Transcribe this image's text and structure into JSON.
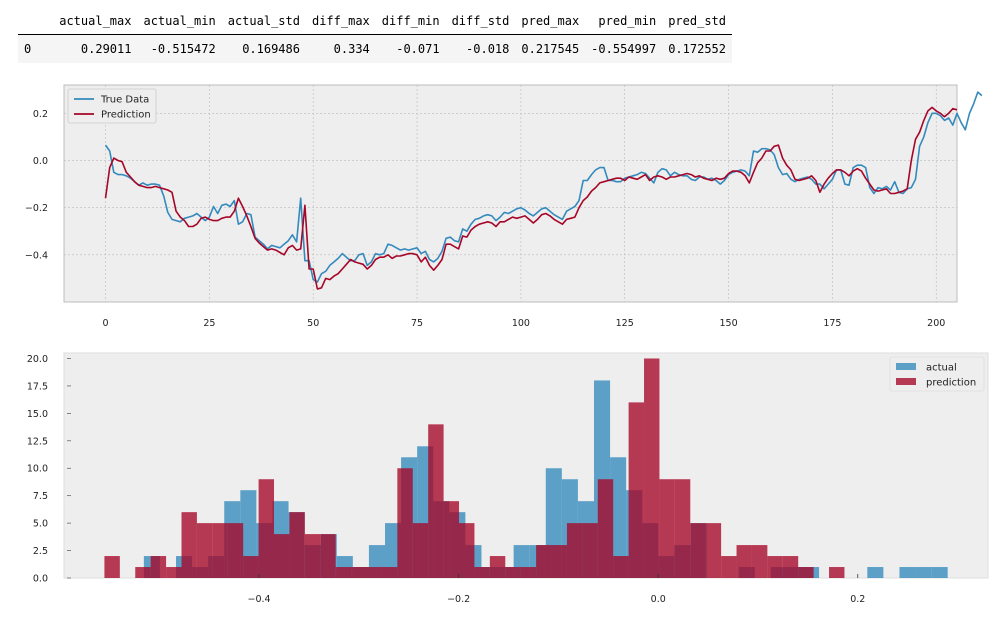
{
  "table": {
    "index_header": "",
    "columns": [
      "actual_max",
      "actual_min",
      "actual_std",
      "diff_max",
      "diff_min",
      "diff_std",
      "pred_max",
      "pred_min",
      "pred_std"
    ],
    "rows": [
      {
        "index": "0",
        "values": [
          "0.29011",
          "-0.515472",
          "0.169486",
          "0.334",
          "-0.071",
          "-0.018",
          "0.217545",
          "-0.554997",
          "0.172552"
        ]
      }
    ]
  },
  "colors": {
    "true_line": "#348ABD",
    "pred_line": "#A60628",
    "hist_actual": "#348ABD",
    "hist_pred": "#A60628",
    "plot_bg": "#EEEEEE",
    "grid": "#BBBBBB"
  },
  "chart_data": [
    {
      "type": "line",
      "title": "",
      "xlabel": "",
      "ylabel": "",
      "xlim": [
        -10,
        205
      ],
      "ylim": [
        -0.6,
        0.32
      ],
      "xticks": [
        0,
        25,
        50,
        75,
        100,
        125,
        150,
        175,
        200
      ],
      "xtick_labels": [
        "0",
        "25",
        "50",
        "75",
        "100",
        "125",
        "150",
        "175",
        "200"
      ],
      "yticks": [
        0.2,
        0.0,
        -0.2,
        -0.4
      ],
      "ytick_labels": [
        "0.2",
        "0.0",
        "−0.2",
        "−0.4"
      ],
      "grid": true,
      "legend_position": "top-left",
      "series": [
        {
          "name": "True Data",
          "values": [
            0.065,
            0.04,
            -0.05,
            -0.06,
            -0.06,
            -0.065,
            -0.075,
            -0.09,
            -0.105,
            -0.095,
            -0.105,
            -0.1,
            -0.1,
            -0.105,
            -0.15,
            -0.22,
            -0.25,
            -0.255,
            -0.26,
            -0.245,
            -0.24,
            -0.235,
            -0.225,
            -0.24,
            -0.255,
            -0.24,
            -0.195,
            -0.225,
            -0.19,
            -0.185,
            -0.195,
            -0.17,
            -0.27,
            -0.26,
            -0.225,
            -0.23,
            -0.325,
            -0.34,
            -0.355,
            -0.375,
            -0.36,
            -0.365,
            -0.37,
            -0.355,
            -0.34,
            -0.315,
            -0.345,
            -0.16,
            -0.425,
            -0.425,
            -0.505,
            -0.515,
            -0.48,
            -0.47,
            -0.445,
            -0.43,
            -0.415,
            -0.395,
            -0.41,
            -0.425,
            -0.425,
            -0.4,
            -0.395,
            -0.445,
            -0.43,
            -0.395,
            -0.4,
            -0.395,
            -0.355,
            -0.36,
            -0.37,
            -0.38,
            -0.375,
            -0.38,
            -0.375,
            -0.37,
            -0.395,
            -0.385,
            -0.42,
            -0.43,
            -0.415,
            -0.385,
            -0.33,
            -0.325,
            -0.34,
            -0.345,
            -0.29,
            -0.3,
            -0.27,
            -0.25,
            -0.245,
            -0.235,
            -0.23,
            -0.235,
            -0.255,
            -0.24,
            -0.22,
            -0.225,
            -0.215,
            -0.205,
            -0.2,
            -0.21,
            -0.225,
            -0.235,
            -0.22,
            -0.205,
            -0.2,
            -0.215,
            -0.23,
            -0.24,
            -0.25,
            -0.215,
            -0.205,
            -0.195,
            -0.17,
            -0.085,
            -0.085,
            -0.06,
            -0.04,
            -0.03,
            -0.03,
            -0.085,
            -0.085,
            -0.09,
            -0.09,
            -0.075,
            -0.07,
            -0.065,
            -0.06,
            -0.05,
            -0.055,
            -0.075,
            -0.095,
            -0.05,
            -0.035,
            -0.04,
            -0.065,
            -0.05,
            -0.06,
            -0.065,
            -0.065,
            -0.08,
            -0.085,
            -0.07,
            -0.07,
            -0.08,
            -0.075,
            -0.085,
            -0.1,
            -0.085,
            -0.06,
            -0.05,
            -0.045,
            -0.04,
            -0.045,
            -0.065,
            0.04,
            0.035,
            0.05,
            0.05,
            0.045,
            0.025,
            -0.03,
            -0.06,
            -0.055,
            -0.08,
            -0.09,
            -0.08,
            -0.075,
            -0.07,
            -0.08,
            -0.1,
            -0.1,
            -0.12,
            -0.1,
            -0.08,
            -0.04,
            -0.04,
            -0.1,
            -0.105,
            -0.03,
            -0.02,
            -0.02,
            -0.03,
            -0.115,
            -0.14,
            -0.115,
            -0.12,
            -0.11,
            -0.125,
            -0.09,
            -0.135,
            -0.14,
            -0.12,
            -0.115,
            -0.08,
            0.06,
            0.1,
            0.16,
            0.2,
            0.2,
            0.19,
            0.17,
            0.18,
            0.15,
            0.2,
            0.16,
            0.13,
            0.2,
            0.24,
            0.29,
            0.275
          ]
        },
        {
          "name": "Prediction",
          "values": [
            -0.16,
            -0.03,
            0.01,
            0.0,
            -0.005,
            -0.05,
            -0.07,
            -0.09,
            -0.105,
            -0.11,
            -0.115,
            -0.115,
            -0.11,
            -0.115,
            -0.12,
            -0.125,
            -0.135,
            -0.215,
            -0.24,
            -0.255,
            -0.28,
            -0.28,
            -0.27,
            -0.245,
            -0.24,
            -0.25,
            -0.255,
            -0.255,
            -0.245,
            -0.24,
            -0.24,
            -0.215,
            -0.16,
            -0.195,
            -0.235,
            -0.28,
            -0.33,
            -0.35,
            -0.365,
            -0.38,
            -0.375,
            -0.38,
            -0.39,
            -0.4,
            -0.37,
            -0.36,
            -0.38,
            -0.375,
            -0.19,
            -0.46,
            -0.46,
            -0.545,
            -0.54,
            -0.5,
            -0.505,
            -0.49,
            -0.48,
            -0.46,
            -0.44,
            -0.42,
            -0.43,
            -0.435,
            -0.44,
            -0.46,
            -0.445,
            -0.42,
            -0.41,
            -0.41,
            -0.4,
            -0.415,
            -0.405,
            -0.405,
            -0.4,
            -0.395,
            -0.395,
            -0.4,
            -0.43,
            -0.41,
            -0.445,
            -0.465,
            -0.445,
            -0.42,
            -0.355,
            -0.355,
            -0.365,
            -0.375,
            -0.32,
            -0.325,
            -0.295,
            -0.28,
            -0.27,
            -0.265,
            -0.26,
            -0.265,
            -0.28,
            -0.26,
            -0.26,
            -0.25,
            -0.24,
            -0.245,
            -0.24,
            -0.235,
            -0.25,
            -0.265,
            -0.25,
            -0.23,
            -0.225,
            -0.235,
            -0.25,
            -0.26,
            -0.27,
            -0.25,
            -0.245,
            -0.24,
            -0.2,
            -0.17,
            -0.155,
            -0.13,
            -0.115,
            -0.095,
            -0.09,
            -0.085,
            -0.08,
            -0.075,
            -0.075,
            -0.085,
            -0.07,
            -0.075,
            -0.08,
            -0.07,
            -0.06,
            -0.085,
            -0.07,
            -0.065,
            -0.07,
            -0.08,
            -0.07,
            -0.07,
            -0.065,
            -0.06,
            -0.055,
            -0.06,
            -0.07,
            -0.065,
            -0.075,
            -0.08,
            -0.085,
            -0.075,
            -0.08,
            -0.075,
            -0.055,
            -0.045,
            -0.045,
            -0.05,
            -0.065,
            -0.095,
            -0.05,
            -0.01,
            0.01,
            0.04,
            0.04,
            0.06,
            0.065,
            0.01,
            -0.02,
            -0.04,
            -0.08,
            -0.085,
            -0.08,
            -0.075,
            -0.065,
            -0.085,
            -0.135,
            -0.1,
            -0.075,
            -0.055,
            -0.04,
            -0.04,
            -0.05,
            -0.065,
            -0.045,
            -0.035,
            -0.045,
            -0.075,
            -0.1,
            -0.125,
            -0.13,
            -0.125,
            -0.12,
            -0.14,
            -0.14,
            -0.135,
            -0.13,
            -0.12,
            0.0,
            0.09,
            0.12,
            0.17,
            0.21,
            0.225,
            0.21,
            0.2,
            0.185,
            0.2,
            0.22,
            0.215
          ]
        }
      ]
    },
    {
      "type": "bar",
      "subtype": "histogram",
      "title": "",
      "xlabel": "",
      "ylabel": "",
      "xlim": [
        -0.5955,
        0.3305
      ],
      "ylim": [
        0,
        20.5
      ],
      "xticks": [
        -0.4,
        -0.2,
        0.0,
        0.2
      ],
      "xtick_labels": [
        "−0.4",
        "−0.2",
        "0.0",
        "0.2"
      ],
      "yticks": [
        0,
        2.5,
        5,
        7.5,
        10,
        12.5,
        15,
        17.5,
        20
      ],
      "ytick_labels": [
        "0.0",
        "2.5",
        "5.0",
        "7.5",
        "10.0",
        "12.5",
        "15.0",
        "17.5",
        "20.0"
      ],
      "grid": false,
      "legend_position": "top-right",
      "series": [
        {
          "name": "actual",
          "bin_start": -0.515472,
          "bin_end": 0.29011,
          "counts": [
            2,
            0,
            2,
            1,
            2,
            7,
            8,
            5,
            7,
            6,
            3,
            4,
            2,
            1,
            3,
            5,
            11,
            12,
            7,
            6,
            3,
            1,
            1,
            3,
            3,
            10,
            9,
            7,
            18,
            11,
            8,
            5,
            2,
            3,
            5,
            0,
            0,
            1,
            0,
            1,
            1,
            1,
            0,
            0,
            0,
            1,
            0,
            1,
            1,
            1
          ]
        },
        {
          "name": "prediction",
          "bin_start": -0.554997,
          "bin_end": 0.217545,
          "counts": [
            2,
            0,
            1,
            2,
            1,
            6,
            5,
            5,
            5,
            2,
            9,
            4,
            6,
            4,
            4,
            1,
            1,
            1,
            1,
            10,
            5,
            14,
            7,
            5,
            1,
            2,
            1,
            1,
            3,
            3,
            5,
            5,
            9,
            2,
            16,
            20,
            9,
            9,
            5,
            5,
            2,
            3,
            3,
            2,
            2,
            1,
            0,
            1,
            0,
            0
          ]
        }
      ]
    }
  ]
}
